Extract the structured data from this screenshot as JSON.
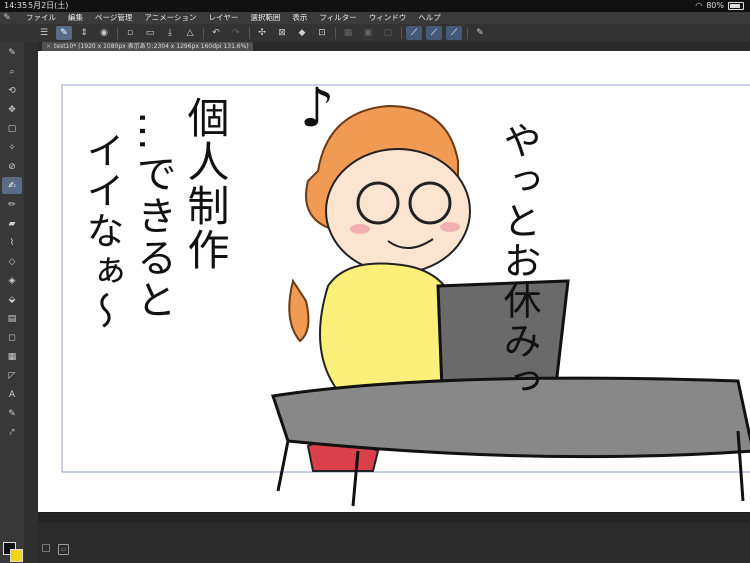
{
  "status": {
    "time": "14:35",
    "date": "5月2日(土)",
    "battery": "80%"
  },
  "menu": {
    "items": [
      "ファイル",
      "編集",
      "ページ管理",
      "アニメーション",
      "レイヤー",
      "選択範囲",
      "表示",
      "フィルター",
      "ウィンドウ",
      "ヘルプ"
    ]
  },
  "canvas_tab": {
    "title": "test10* (1920 x 1080px 表示あり:2304 x 1296px 160dpi 131.6%)"
  },
  "artwork": {
    "col1": "やっとお休みっ",
    "col2": "個人制作",
    "col3": "…できると",
    "col4": "イイなぁ〜",
    "note": "♪"
  },
  "colors": {
    "main": "#111111",
    "sub": "#f6d414",
    "accent": "#5a6b86"
  }
}
